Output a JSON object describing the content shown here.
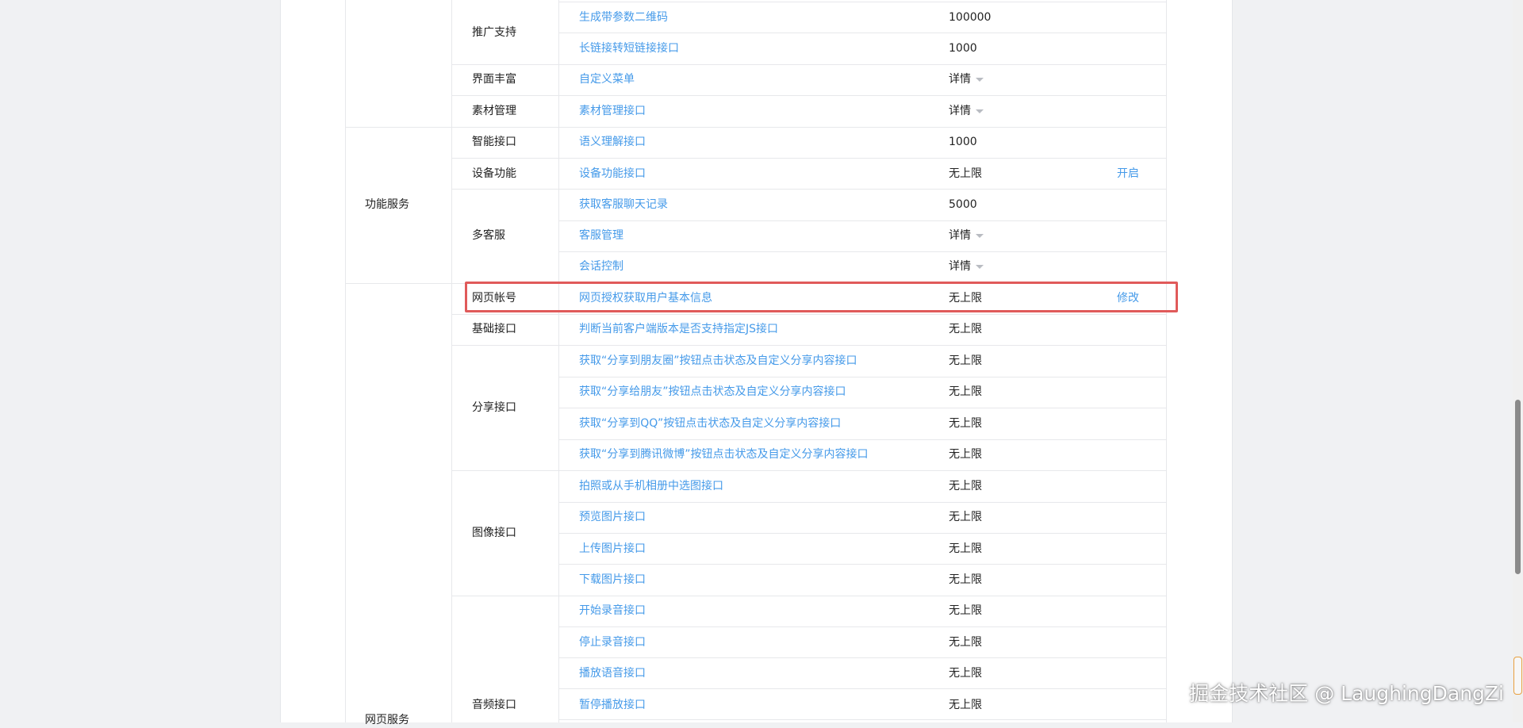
{
  "table": {
    "categories": [
      "功能服务",
      "网页服务"
    ],
    "groups": [
      "推广支持",
      "界面丰富",
      "素材管理",
      "智能接口",
      "设备功能",
      "多客服",
      "网页帐号",
      "基础接口",
      "分享接口",
      "图像接口",
      "音频接口"
    ],
    "rows": [
      {
        "api": "生成带参数二维码",
        "quota": "100000"
      },
      {
        "api": "长链接转短链接接口",
        "quota": "1000"
      },
      {
        "api": "自定义菜单",
        "quota": "详情"
      },
      {
        "api": "素材管理接口",
        "quota": "详情"
      },
      {
        "api": "语义理解接口",
        "quota": "1000"
      },
      {
        "api": "设备功能接口",
        "quota": "无上限",
        "op": "开启"
      },
      {
        "api": "获取客服聊天记录",
        "quota": "5000"
      },
      {
        "api": "客服管理",
        "quota": "详情"
      },
      {
        "api": "会话控制",
        "quota": "详情"
      },
      {
        "api": "网页授权获取用户基本信息",
        "quota": "无上限",
        "op": "修改"
      },
      {
        "api": "判断当前客户端版本是否支持指定JS接口",
        "quota": "无上限"
      },
      {
        "api": "获取“分享到朋友圈”按钮点击状态及自定义分享内容接口",
        "quota": "无上限"
      },
      {
        "api": "获取“分享给朋友”按钮点击状态及自定义分享内容接口",
        "quota": "无上限"
      },
      {
        "api": "获取“分享到QQ”按钮点击状态及自定义分享内容接口",
        "quota": "无上限"
      },
      {
        "api": "获取“分享到腾讯微博”按钮点击状态及自定义分享内容接口",
        "quota": "无上限"
      },
      {
        "api": "拍照或从手机相册中选图接口",
        "quota": "无上限"
      },
      {
        "api": "预览图片接口",
        "quota": "无上限"
      },
      {
        "api": "上传图片接口",
        "quota": "无上限"
      },
      {
        "api": "下载图片接口",
        "quota": "无上限"
      },
      {
        "api": "开始录音接口",
        "quota": "无上限"
      },
      {
        "api": "停止录音接口",
        "quota": "无上限"
      },
      {
        "api": "播放语音接口",
        "quota": "无上限"
      },
      {
        "api": "暂停播放接口",
        "quota": "无上限"
      }
    ]
  },
  "highlighted_row": "网页授权获取用户基本信息",
  "watermark": "掘金技术社区 @ LaughingDangZi",
  "colors": {
    "link": "#459ae9",
    "highlight_border": "#e05a5a",
    "grid": "#e7e8eb",
    "page_background": "#f0f1f3"
  },
  "icons": {
    "details_dropdown": "caret-down-icon"
  }
}
